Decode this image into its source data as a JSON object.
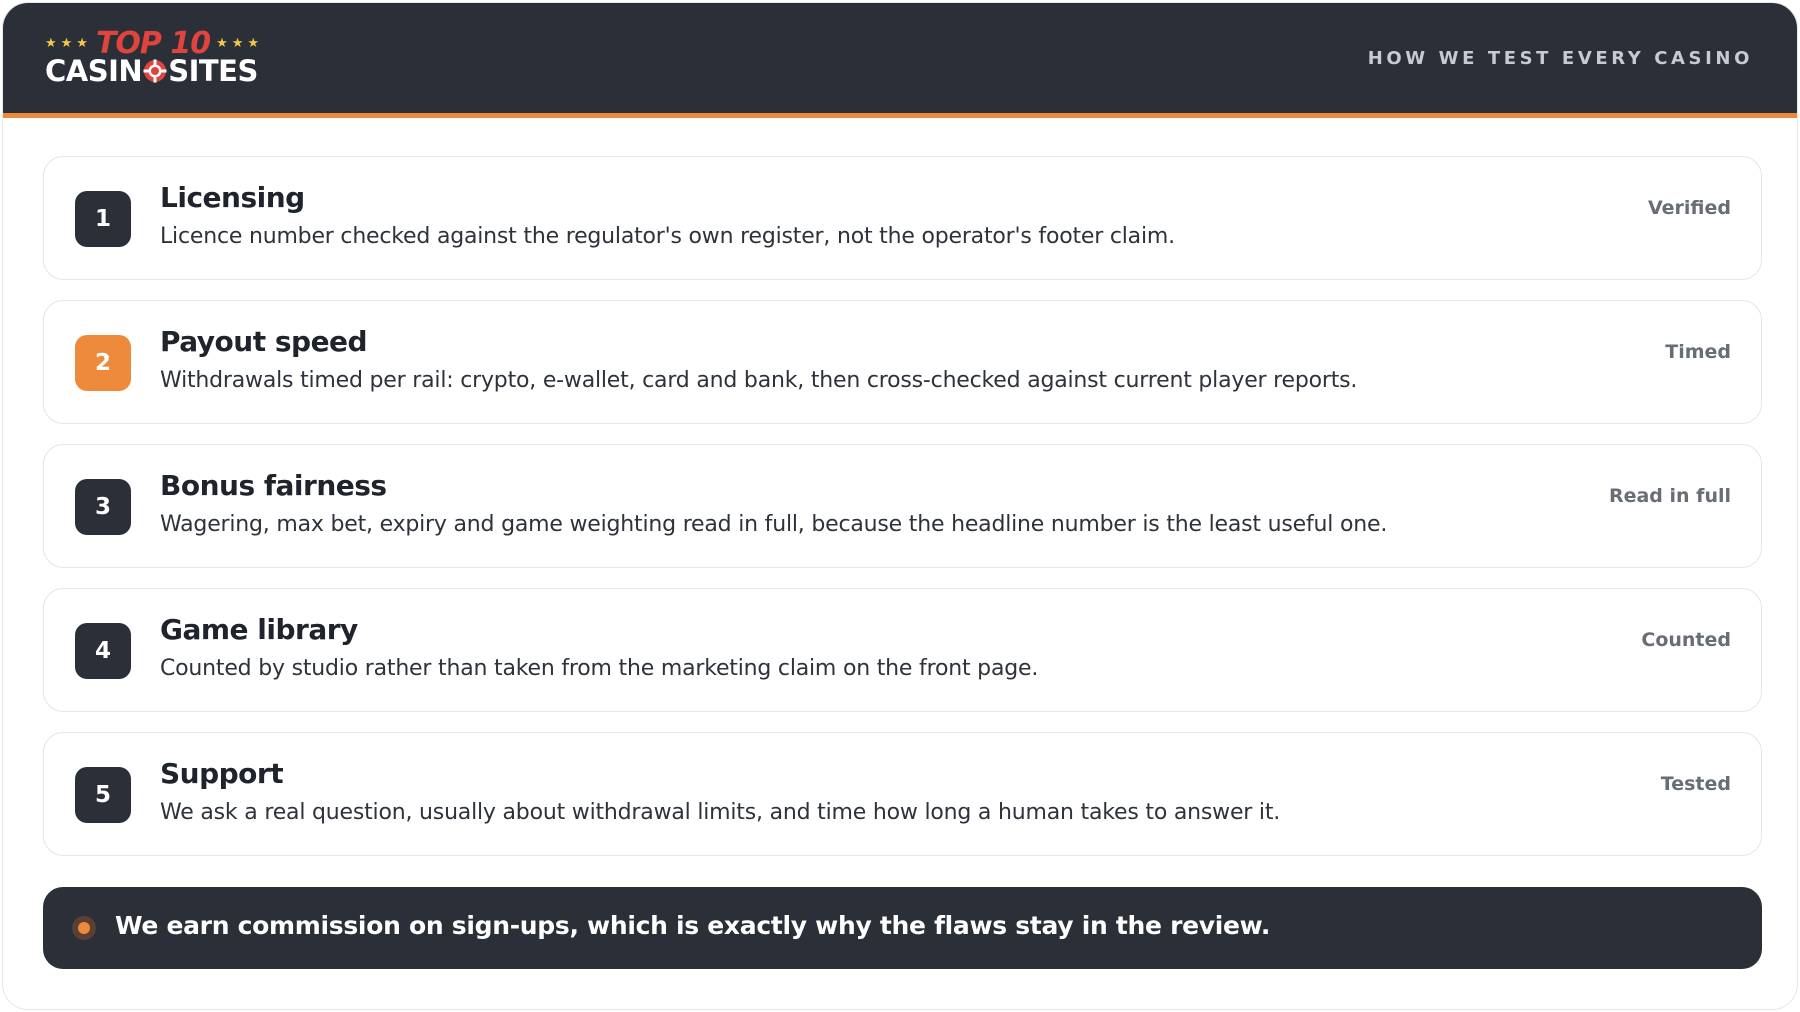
{
  "brand": {
    "stars": "★★★",
    "top_label": "TOP 10",
    "name_part1": "CASIN",
    "name_part2": "SITES",
    "colors": {
      "star": "#f3c84b",
      "top": "#e0443c",
      "chip": "#e0443c"
    }
  },
  "header": {
    "nav_label": "HOW WE TEST EVERY CASINO",
    "background": "#2a2f38",
    "accent": "#ec8a3a"
  },
  "steps": [
    {
      "number": "1",
      "title": "Licensing",
      "description": "Licence number checked against the regulator's own register, not the operator's footer claim.",
      "status": "Verified",
      "highlighted": false
    },
    {
      "number": "2",
      "title": "Payout speed",
      "description": "Withdrawals timed per rail: crypto, e-wallet, card and bank, then cross-checked against current player reports.",
      "status": "Timed",
      "highlighted": true
    },
    {
      "number": "3",
      "title": "Bonus fairness",
      "description": "Wagering, max bet, expiry and game weighting read in full, because the headline number is the least useful one.",
      "status": "Read in full",
      "highlighted": false
    },
    {
      "number": "4",
      "title": "Game library",
      "description": "Counted by studio rather than taken from the marketing claim on the front page.",
      "status": "Counted",
      "highlighted": false
    },
    {
      "number": "5",
      "title": "Support",
      "description": "We ask a real question, usually about withdrawal limits, and time how long a human takes to answer it.",
      "status": "Tested",
      "highlighted": false
    }
  ],
  "notice": {
    "text": "We earn commission on sign-ups, which is exactly why the flaws stay in the review.",
    "icon": "status-dot-icon"
  }
}
